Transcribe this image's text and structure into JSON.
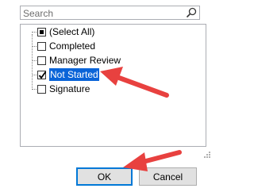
{
  "search": {
    "placeholder": "Search",
    "icon": "search-icon"
  },
  "filter_list": {
    "items": [
      {
        "label": "(Select All)",
        "state": "partial"
      },
      {
        "label": "Completed",
        "state": "unchecked"
      },
      {
        "label": "Manager Review",
        "state": "unchecked"
      },
      {
        "label": "Not Started",
        "state": "checked",
        "selected": true
      },
      {
        "label": "Signature",
        "state": "unchecked"
      }
    ]
  },
  "buttons": {
    "ok_label": "OK",
    "cancel_label": "Cancel"
  },
  "colors": {
    "selection": "#0a64d8",
    "annotation_arrow": "#e8413f",
    "ok_border": "#0078d7"
  }
}
